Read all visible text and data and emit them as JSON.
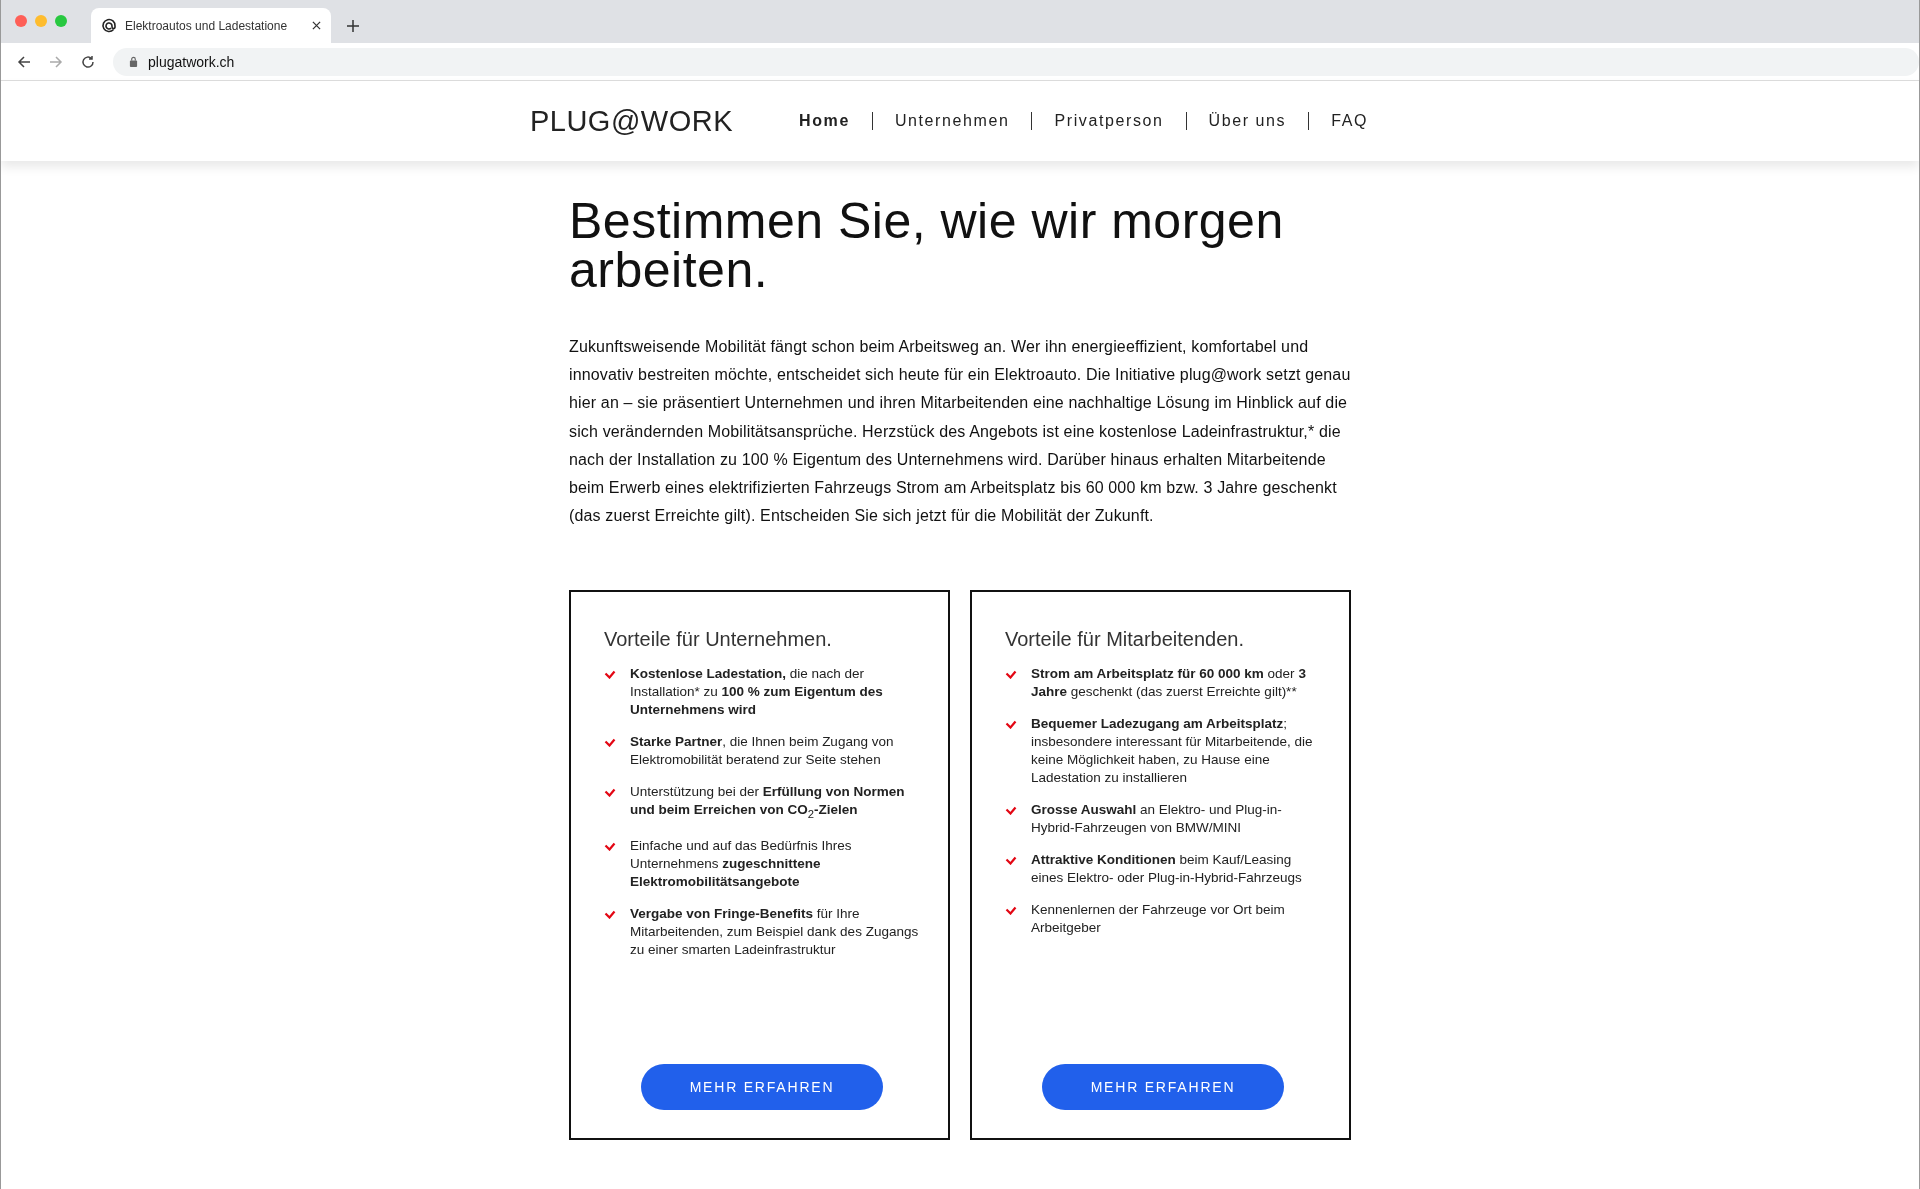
{
  "browser": {
    "tab_title": "Elektroautos und Ladestatione",
    "address": "plugatwork.ch"
  },
  "header": {
    "logo": "PLUG@WORK",
    "nav": [
      {
        "label": "Home",
        "selected": true
      },
      {
        "label": "Unternehmen",
        "selected": false
      },
      {
        "label": "Privatperson",
        "selected": false
      },
      {
        "label": "Über uns",
        "selected": false
      },
      {
        "label": "FAQ",
        "selected": false
      }
    ]
  },
  "hero": {
    "title": "Bestimmen Sie, wie wir morgen arbeiten.",
    "text": "Zukunftsweisende Mobilität fängt schon beim Arbeitsweg an. Wer ihn energieeffizient, komfortabel und innovativ bestreiten möchte, entscheidet sich heute für ein Elektroauto. Die Initiative plug@work setzt genau hier an – sie präsentiert Unternehmen und ihren Mitarbeitenden eine nachhaltige Lösung im Hinblick auf die sich verändernden Mobilitätsansprüche. Herzstück des Angebots ist eine kostenlose Ladeinfrastruktur,* die nach der Installation zu 100 % Eigentum des Unternehmens wird. Darüber hinaus erhalten Mitarbeitende beim Erwerb eines elektrifizierten Fahrzeugs Strom am Arbeitsplatz bis 60 000 km bzw. 3 Jahre geschenkt (das zuerst Erreichte gilt). Entscheiden Sie sich jetzt für die Mobilität der Zukunft."
  },
  "cards": [
    {
      "title": "Vorteile für Unternehmen.",
      "items": [
        "**Kostenlose Ladestation,** die nach der Installation* zu **100 % zum Eigentum des Unternehmens wird**",
        "**Starke Partner**, die Ihnen beim Zugang von Elektromobilität beratend zur Seite stehen",
        "Unterstützung bei der **Erfüllung von Normen und beim Erreichen von CO**$_{2}$**-Zielen**",
        "Einfache und auf das Bedürfnis Ihres Unternehmens **zugeschnittene Elektromobilitätsangebote**",
        "**Vergabe von Fringe-Benefits** für Ihre Mitarbeitenden, zum Beispiel dank des Zugangs zu einer smarten Ladeinfrastruktur"
      ],
      "button": "MEHR ERFAHREN"
    },
    {
      "title": "Vorteile für Mitarbeitenden.",
      "items": [
        "**Strom am Arbeitsplatz für 60 000 km** oder **3 Jahre** geschenkt (das zuerst Erreichte gilt)**",
        "**Bequemer Ladezugang am Arbeitsplatz**; insbesondere interessant für Mitarbeitende, die keine Möglichkeit haben, zu Hause eine Ladestation zu installieren",
        "**Grosse Auswahl** an Elektro- und Plug-in-Hybrid-Fahrzeugen von BMW/MINI",
        "**Attraktive Konditionen** beim Kauf/Leasing eines Elektro- oder Plug-in-Hybrid-Fahrzeugs",
        "Kennenlernen der Fahrzeuge vor Ort beim Arbeitgeber"
      ],
      "button": "MEHR ERFAHREN"
    }
  ]
}
